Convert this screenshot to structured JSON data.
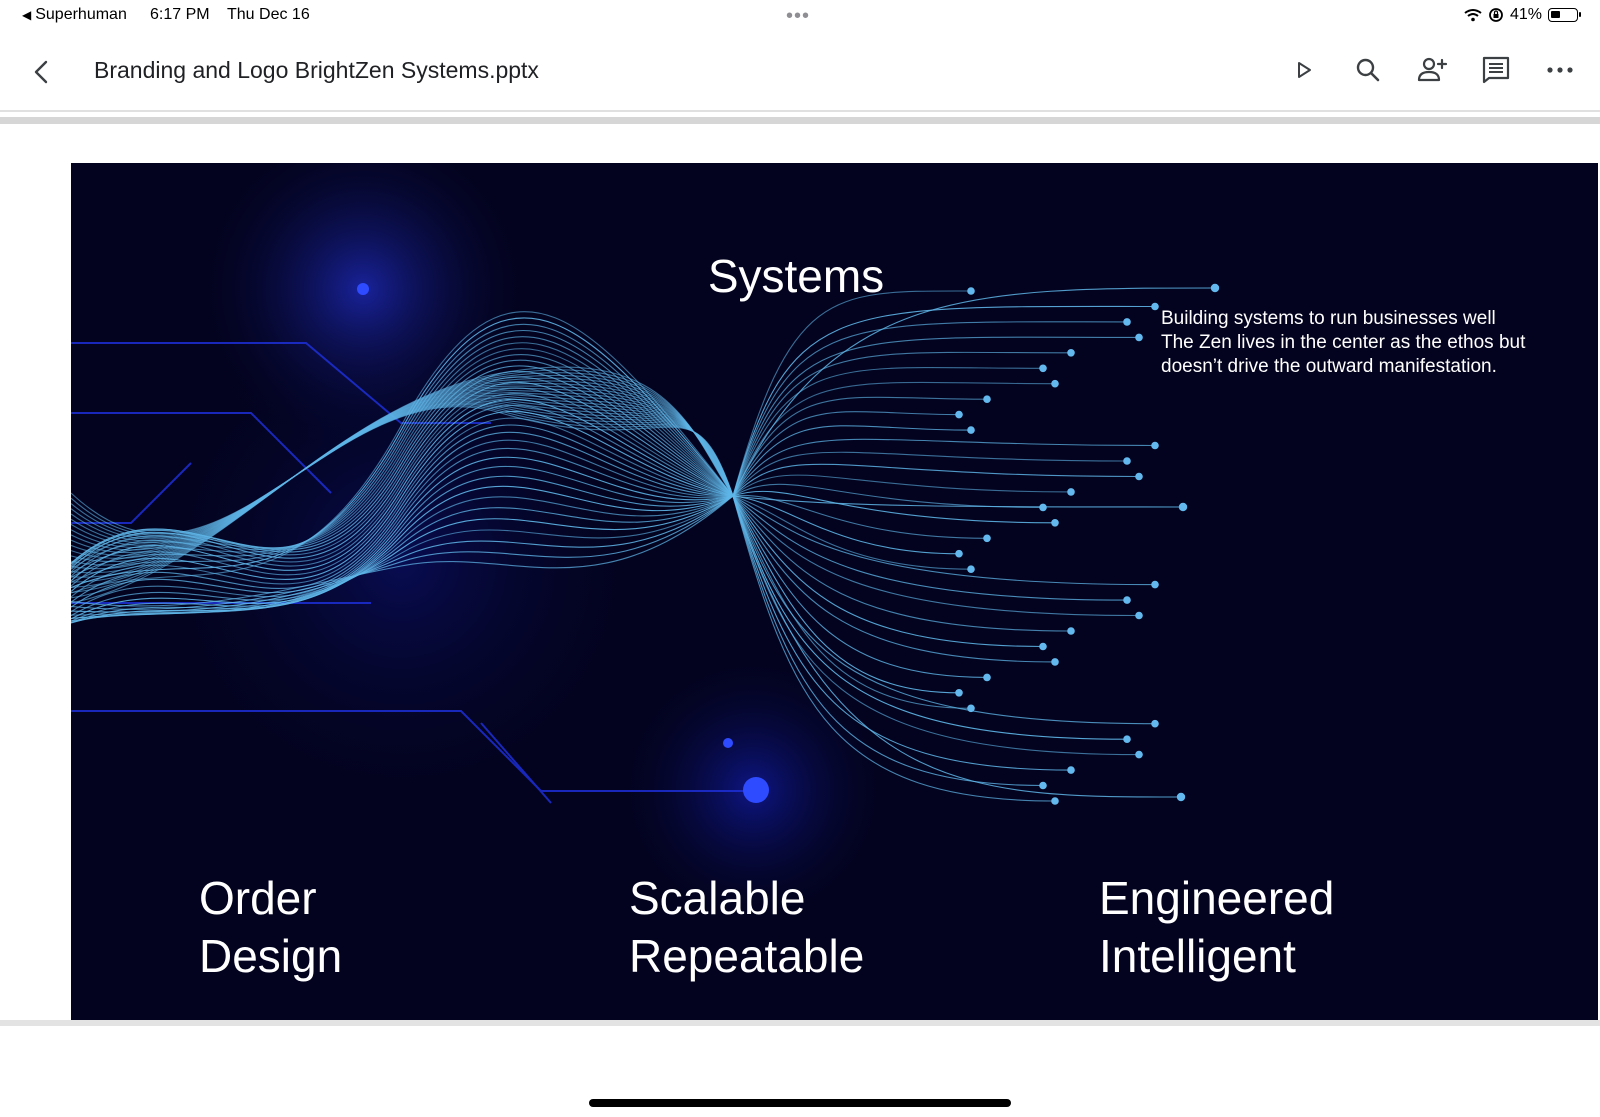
{
  "status_bar": {
    "back_app": "Superhuman",
    "time": "6:17 PM",
    "date": "Thu Dec 16",
    "battery_text": "41%",
    "battery_level": 0.41,
    "icons": [
      "wifi-icon",
      "orientation-lock-icon",
      "battery-icon"
    ]
  },
  "app_bar": {
    "back_icon": "chevron-left-icon",
    "title": "Branding and Logo BrightZen Systems.pptx",
    "actions": [
      "present-icon",
      "search-icon",
      "share-add-person-icon",
      "comments-icon",
      "more-icon"
    ]
  },
  "slide": {
    "heading": "Systems",
    "description": [
      "Building systems to run businesses well",
      "The Zen lives in the center as the ethos but",
      "doesn’t drive the outward manifestation."
    ],
    "pillars": [
      {
        "line1": "Order",
        "line2": "Design"
      },
      {
        "line1": "Scalable",
        "line2": "Repeatable"
      },
      {
        "line1": "Engineered",
        "line2": "Intelligent"
      }
    ],
    "colors": {
      "background": "#03031f",
      "wave": "#5fb6e8",
      "glow": "#1f3cff"
    }
  }
}
